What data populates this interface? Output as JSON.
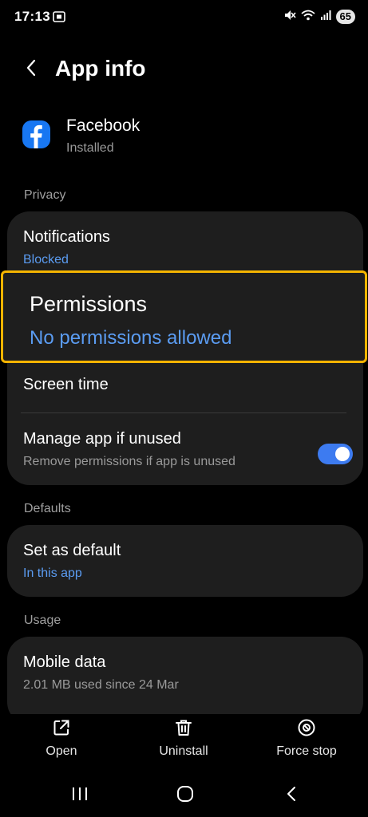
{
  "status_bar": {
    "time": "17:13",
    "battery": "65",
    "icons": [
      "screenshot-icon",
      "mute-icon",
      "wifi-icon",
      "signal-icon",
      "battery-icon"
    ]
  },
  "header": {
    "back_icon": "chevron-left-icon",
    "title": "App info"
  },
  "app": {
    "name": "Facebook",
    "status": "Installed",
    "icon": "facebook-icon",
    "brand_color": "#1877f2"
  },
  "sections": {
    "privacy_label": "Privacy",
    "defaults_label": "Defaults",
    "usage_label": "Usage"
  },
  "privacy": {
    "notifications": {
      "title": "Notifications",
      "value": "Blocked"
    },
    "permissions": {
      "title": "Permissions",
      "value": "No permissions allowed"
    },
    "screen_time": {
      "title": "Screen time"
    },
    "manage_unused": {
      "title": "Manage app if unused",
      "subtitle": "Remove permissions if app is unused",
      "enabled": true
    }
  },
  "defaults": {
    "set_default": {
      "title": "Set as default",
      "value": "In this app"
    }
  },
  "usage": {
    "mobile_data": {
      "title": "Mobile data",
      "value": "2.01 MB used since 24 Mar"
    }
  },
  "actions": {
    "open": {
      "label": "Open",
      "icon": "open-external-icon"
    },
    "uninstall": {
      "label": "Uninstall",
      "icon": "trash-icon"
    },
    "force_stop": {
      "label": "Force stop",
      "icon": "block-icon"
    }
  },
  "colors": {
    "accent_blue": "#5b9cf2",
    "toggle_on": "#3d7bf0",
    "highlight_border": "#f4b400",
    "card_bg": "#1e1e1e"
  },
  "nav": {
    "icons": [
      "recents-icon",
      "home-icon",
      "back-icon"
    ]
  }
}
